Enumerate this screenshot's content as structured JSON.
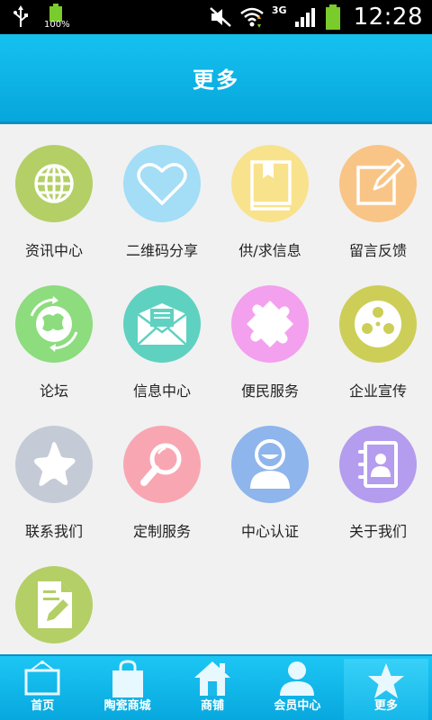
{
  "status_bar": {
    "battery_small_pct": "100%",
    "network": "3G",
    "time": "12:28"
  },
  "header": {
    "title": "更多"
  },
  "grid": {
    "items": [
      {
        "label": "资讯中心",
        "icon": "globe-icon",
        "color": "#b3cf66"
      },
      {
        "label": "二维码分享",
        "icon": "heart-icon",
        "color": "#a3ddf6"
      },
      {
        "label": "供/求信息",
        "icon": "book-icon",
        "color": "#f8e28b"
      },
      {
        "label": "留言反馈",
        "icon": "edit-icon",
        "color": "#f9c586"
      },
      {
        "label": "论坛",
        "icon": "globe-arrows-icon",
        "color": "#8ddc7e"
      },
      {
        "label": "信息中心",
        "icon": "envelope-icon",
        "color": "#5fd1c0"
      },
      {
        "label": "便民服务",
        "icon": "puzzle-icon",
        "color": "#f3a0ee"
      },
      {
        "label": "企业宣传",
        "icon": "film-reel-icon",
        "color": "#cdce58"
      },
      {
        "label": "联系我们",
        "icon": "star-icon",
        "color": "#c5cbd6"
      },
      {
        "label": "定制服务",
        "icon": "magnifier-icon",
        "color": "#f9a6b3"
      },
      {
        "label": "中心认证",
        "icon": "user-icon",
        "color": "#8eb5ec"
      },
      {
        "label": "关于我们",
        "icon": "contact-book-icon",
        "color": "#b49cee"
      },
      {
        "label": "",
        "icon": "document-edit-icon",
        "color": "#b3cf66"
      }
    ]
  },
  "bottom_nav": {
    "items": [
      {
        "label": "首页",
        "icon": "frame-icon",
        "active": false
      },
      {
        "label": "陶瓷商城",
        "icon": "bag-icon",
        "active": false
      },
      {
        "label": "商铺",
        "icon": "house-icon",
        "active": false
      },
      {
        "label": "会员中心",
        "icon": "person-icon",
        "active": false
      },
      {
        "label": "更多",
        "icon": "star-icon",
        "active": true
      }
    ]
  }
}
